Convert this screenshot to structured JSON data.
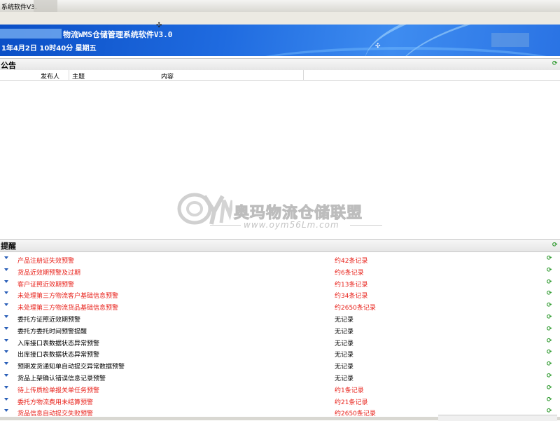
{
  "window": {
    "title": "系统软件V3."
  },
  "banner": {
    "app_name": "物流WMS仓储管理系统软件V3.0",
    "date_line": "1年4月2日  10时40分    星期五"
  },
  "announcement": {
    "title": "公告",
    "columns": [
      "发布人",
      "主题",
      "内容"
    ]
  },
  "watermark": {
    "brand_text": "奥玛物流仓储联盟",
    "url_text": "www.oym56Lm.com"
  },
  "reminders": {
    "title": "提醒",
    "items": [
      {
        "name": "产品注册证失效预警",
        "count": "约42条记录",
        "color": "red"
      },
      {
        "name": "货品近效期预警及过期",
        "count": "约6条记录",
        "color": "red"
      },
      {
        "name": "客户证照近效期预警",
        "count": "约13条记录",
        "color": "red"
      },
      {
        "name": "未处理第三方物流客户基础信息预警",
        "count": "约34条记录",
        "color": "red"
      },
      {
        "name": "未处理第三方物流货品基础信息预警",
        "count": "约2650条记录",
        "color": "red"
      },
      {
        "name": "委托方证照近效期预警",
        "count": "无记录",
        "color": "black"
      },
      {
        "name": "委托方委托时间预警提醒",
        "count": "无记录",
        "color": "black"
      },
      {
        "name": "入库接口表数据状态异常预警",
        "count": "无记录",
        "color": "black"
      },
      {
        "name": "出库接口表数据状态异常预警",
        "count": "无记录",
        "color": "black"
      },
      {
        "name": "预期发货通知单自动提交异常数据预警",
        "count": "无记录",
        "color": "black"
      },
      {
        "name": "货品上架确认错误信息记录预警",
        "count": "无记录",
        "color": "black"
      },
      {
        "name": "待上传质检单报关单任务预警",
        "count": "约1条记录",
        "color": "red"
      },
      {
        "name": "委托方物流费用未结算预警",
        "count": "约21条记录",
        "color": "red"
      },
      {
        "name": "货品信息自动提交失败预警",
        "count": "约2650条记录",
        "color": "red"
      }
    ]
  },
  "icons": {
    "refresh": "refresh-icon",
    "bullet": "dropdown-bullet-icon",
    "cursor": "crosshair-cursor-icon"
  },
  "colors": {
    "banner_blue": "#1f6be0",
    "alert_red": "#e8221b",
    "refresh_green": "#2f9a2f"
  }
}
